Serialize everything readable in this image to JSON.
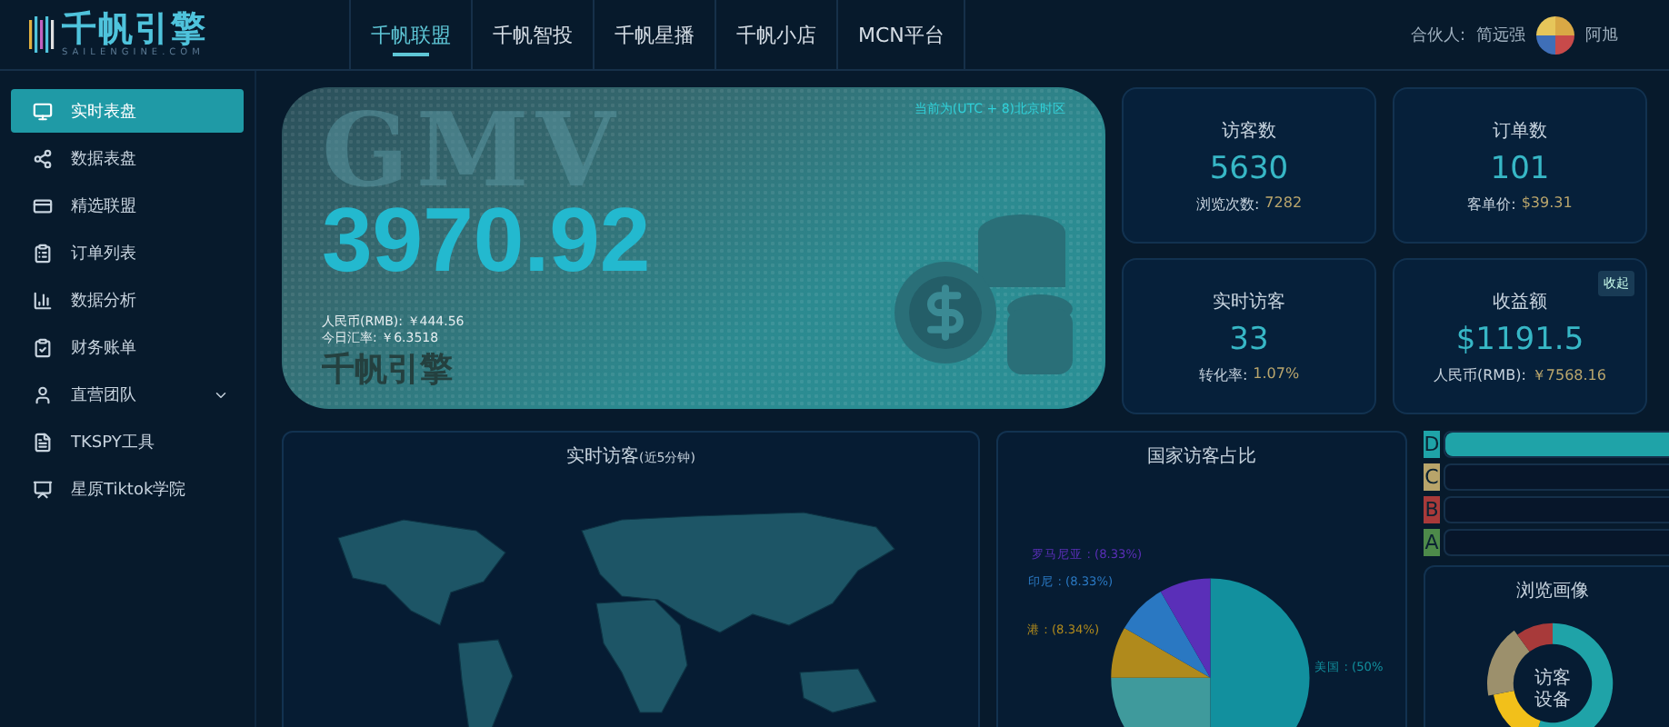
{
  "logo": {
    "title": "千帆引擎",
    "subtitle": "SAILENGINE.COM"
  },
  "nav_tabs": [
    {
      "label": "千帆联盟",
      "selected": true
    },
    {
      "label": "千帆智投",
      "selected": false
    },
    {
      "label": "千帆星播",
      "selected": false
    },
    {
      "label": "千帆小店",
      "selected": false
    },
    {
      "label": "MCN平台",
      "selected": false
    }
  ],
  "user": {
    "partner_label": "合伙人:",
    "partner_name": "简远强",
    "name": "阿旭"
  },
  "sidebar": {
    "items": [
      {
        "label": "实时表盘",
        "selected": true
      },
      {
        "label": "数据表盘",
        "selected": false
      },
      {
        "label": "精选联盟",
        "selected": false
      },
      {
        "label": "订单列表",
        "selected": false
      },
      {
        "label": "数据分析",
        "selected": false
      },
      {
        "label": "财务账单",
        "selected": false
      },
      {
        "label": "直营团队",
        "selected": false,
        "expanded": false
      },
      {
        "label": "TKSPY工具",
        "selected": false
      },
      {
        "label": "星原Tiktok学院",
        "selected": false
      }
    ]
  },
  "gmv": {
    "heading": "GMV",
    "timezone": "当前为(UTC + 8)北京时区",
    "value": "3970.92",
    "rmb": "人民币(RMB): ￥444.56",
    "rate": "今日汇率: ￥6.3518",
    "ghost_text": "千帆引擎"
  },
  "stats": [
    {
      "title": "访客数",
      "value": "5630",
      "sub_label": "浏览次数:",
      "sub_value": "7282"
    },
    {
      "title": "订单数",
      "value": "101",
      "sub_label": "客单价:",
      "sub_value": "$39.31"
    },
    {
      "title": "实时访客",
      "value": "33",
      "sub_label": "转化率:",
      "sub_value": "1.07%"
    },
    {
      "title": "收益额",
      "value": "$1191.5",
      "sub_label": "人民币(RMB):",
      "sub_value": "￥7568.16",
      "action": "收起"
    }
  ],
  "map_panel": {
    "title": "实时访客",
    "title_note": "(近5分钟)"
  },
  "pie_panel": {
    "title": "国家访客占比",
    "labels": [
      "罗马尼亚 : (8.33%)",
      "印尼 : (8.33%)",
      "港 : (8.34%)",
      "美国 : (50%"
    ],
    "chart_data": {
      "type": "pie",
      "values": [
        50,
        25,
        8.34,
        8.33,
        8.33
      ]
    }
  },
  "grades": [
    {
      "letter": "D",
      "color": "#1fa3a8",
      "level": 1
    },
    {
      "letter": "C",
      "color": "#b8a46a",
      "level": 0
    },
    {
      "letter": "B",
      "color": "#a83a3a",
      "level": 0
    },
    {
      "letter": "A",
      "color": "#4d8a4a",
      "level": 0
    }
  ],
  "profile_panel": {
    "title": "浏览画像",
    "center_lines": [
      "访客",
      "设备"
    ]
  }
}
